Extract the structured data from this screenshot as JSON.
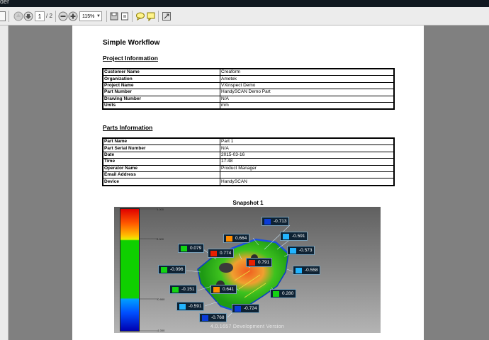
{
  "window": {
    "title_fragment": "der"
  },
  "toolbar": {
    "page_current": "1",
    "page_total": "/ 2",
    "zoom": "115%"
  },
  "document": {
    "title": "Simple Workflow",
    "project_heading": "Project Information",
    "project_rows": [
      {
        "k": "Customer Name",
        "v": "Creaform"
      },
      {
        "k": "Organization",
        "v": "Ametek"
      },
      {
        "k": "Project Name",
        "v": "VXinspect Demo"
      },
      {
        "k": "Part Number",
        "v": "HandySCAN Demo Part"
      },
      {
        "k": "Drawing Number",
        "v": "N/A"
      },
      {
        "k": "Units",
        "v": "mm"
      }
    ],
    "parts_heading": "Parts Information",
    "parts_rows": [
      {
        "k": "Part Name",
        "v": "Part 1"
      },
      {
        "k": "Part Serial Number",
        "v": "N/A"
      },
      {
        "k": "Date",
        "v": "2015-03-16"
      },
      {
        "k": "Time",
        "v": "17:48"
      },
      {
        "k": "Operator Name",
        "v": "Product Manager"
      },
      {
        "k": "Email Address",
        "v": ""
      },
      {
        "k": "Device",
        "v": "HandySCAN"
      }
    ],
    "snapshot_title": "Snapshot 1",
    "scale_labels": {
      "top": "1.000",
      "upper": "0.900",
      "lower": "-0.900",
      "bottom": "-1.000"
    },
    "watermark": "4.0.1657 Development Version",
    "callouts": [
      {
        "value": "-0.713",
        "color": "#0a3cd8"
      },
      {
        "value": "0.664",
        "color": "#ff8c00"
      },
      {
        "value": "-0.591",
        "color": "#22b4ff"
      },
      {
        "value": "0.079",
        "color": "#12d412"
      },
      {
        "value": "0.774",
        "color": "#e82000"
      },
      {
        "value": "-0.573",
        "color": "#22b4ff"
      },
      {
        "value": "0.791",
        "color": "#e82000"
      },
      {
        "value": "-0.096",
        "color": "#12d412"
      },
      {
        "value": "-0.558",
        "color": "#22b4ff"
      },
      {
        "value": "-0.151",
        "color": "#12d412"
      },
      {
        "value": "0.641",
        "color": "#ff8c00"
      },
      {
        "value": "0.280",
        "color": "#12d412"
      },
      {
        "value": "-0.591",
        "color": "#22b4ff"
      },
      {
        "value": "-0.724",
        "color": "#0a3cd8"
      },
      {
        "value": "-0.768",
        "color": "#0a3cd8"
      }
    ]
  }
}
